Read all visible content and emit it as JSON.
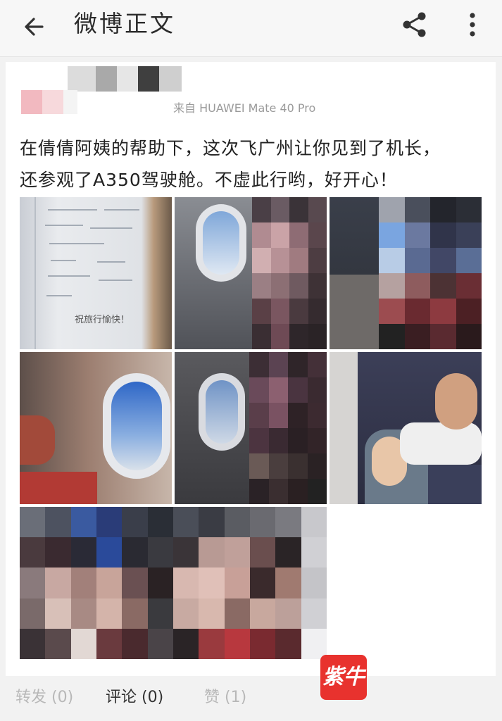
{
  "appbar": {
    "title": "微博正文",
    "back_icon": "arrow-left-icon",
    "share_icon": "share-icon",
    "more_icon": "more-vertical-icon"
  },
  "post": {
    "source": "来自 HUAWEI Mate 40 Pro",
    "line1": "在倩倩阿姨的帮助下，这次飞广州让你见到了机长，",
    "line2": "还参观了A350驾驶舱。不虚此行哟，好开心！",
    "images": [
      {
        "subject": "handwritten note"
      },
      {
        "subject": "airplane window"
      },
      {
        "subject": "cockpit"
      },
      {
        "subject": "airplane window"
      },
      {
        "subject": "airplane window"
      },
      {
        "subject": "flight attendant"
      },
      {
        "subject": "group photo"
      }
    ],
    "note_text": "祝旅行愉快！"
  },
  "actions": {
    "repost": "转发 (0)",
    "comment": "评论 (0)",
    "like": "赞 (1)"
  },
  "watermark": {
    "text": "紫牛",
    "color": "#e8322e"
  }
}
